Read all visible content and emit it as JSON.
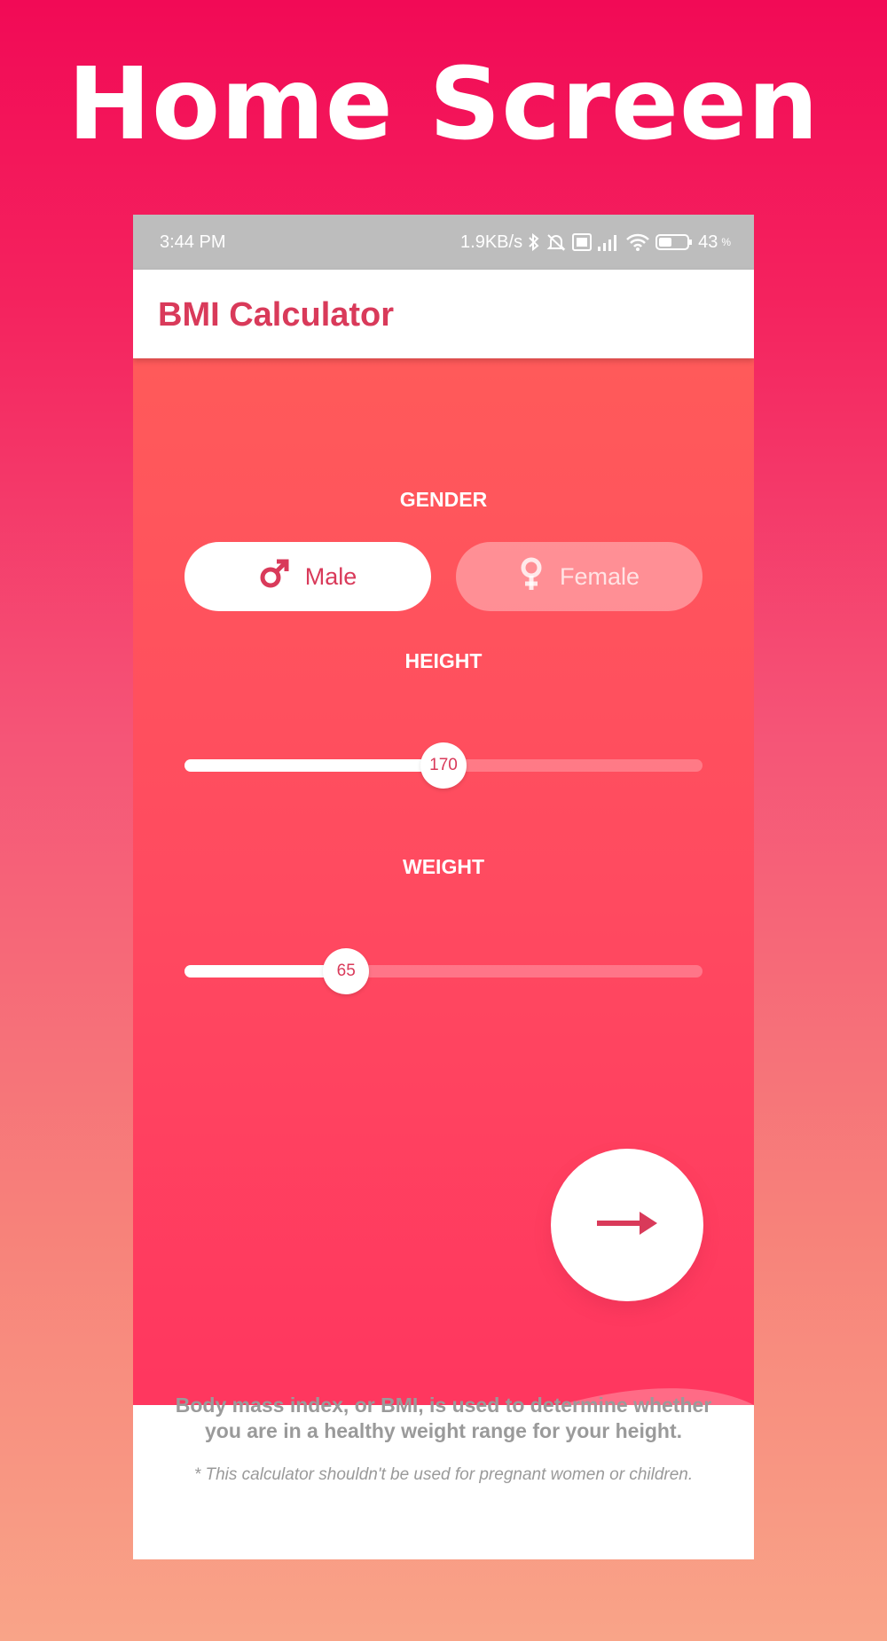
{
  "page": {
    "headline": "Home Screen"
  },
  "status_bar": {
    "time": "3:44 PM",
    "network_speed": "1.9KB/s",
    "battery_level": "43",
    "battery_unit": "%",
    "icons": [
      "bluetooth-icon",
      "alarm-off-icon",
      "volte-icon",
      "signal-icon",
      "wifi-icon",
      "battery-icon"
    ]
  },
  "app_bar": {
    "title": "BMI Calculator"
  },
  "gender": {
    "label": "GENDER",
    "options": [
      {
        "label": "Male",
        "icon": "male-icon",
        "selected": true
      },
      {
        "label": "Female",
        "icon": "female-icon",
        "selected": false
      }
    ]
  },
  "height": {
    "label": "HEIGHT",
    "value": "170",
    "fraction": 0.5
  },
  "weight": {
    "label": "WEIGHT",
    "value": "65",
    "fraction": 0.312
  },
  "next_button": {
    "icon": "arrow-right-icon"
  },
  "info": {
    "description": "Body mass index, or BMI, is used to determine whether you are in a healthy weight range for your height.",
    "note": "* This calculator shouldn't be used for pregnant women or children."
  },
  "colors": {
    "accent": "#d93a5a",
    "gradient_top": "#f20a56",
    "gradient_bottom": "#f9a488",
    "status_bar": "#bdbdbd",
    "muted_text": "#9a9a9a"
  }
}
